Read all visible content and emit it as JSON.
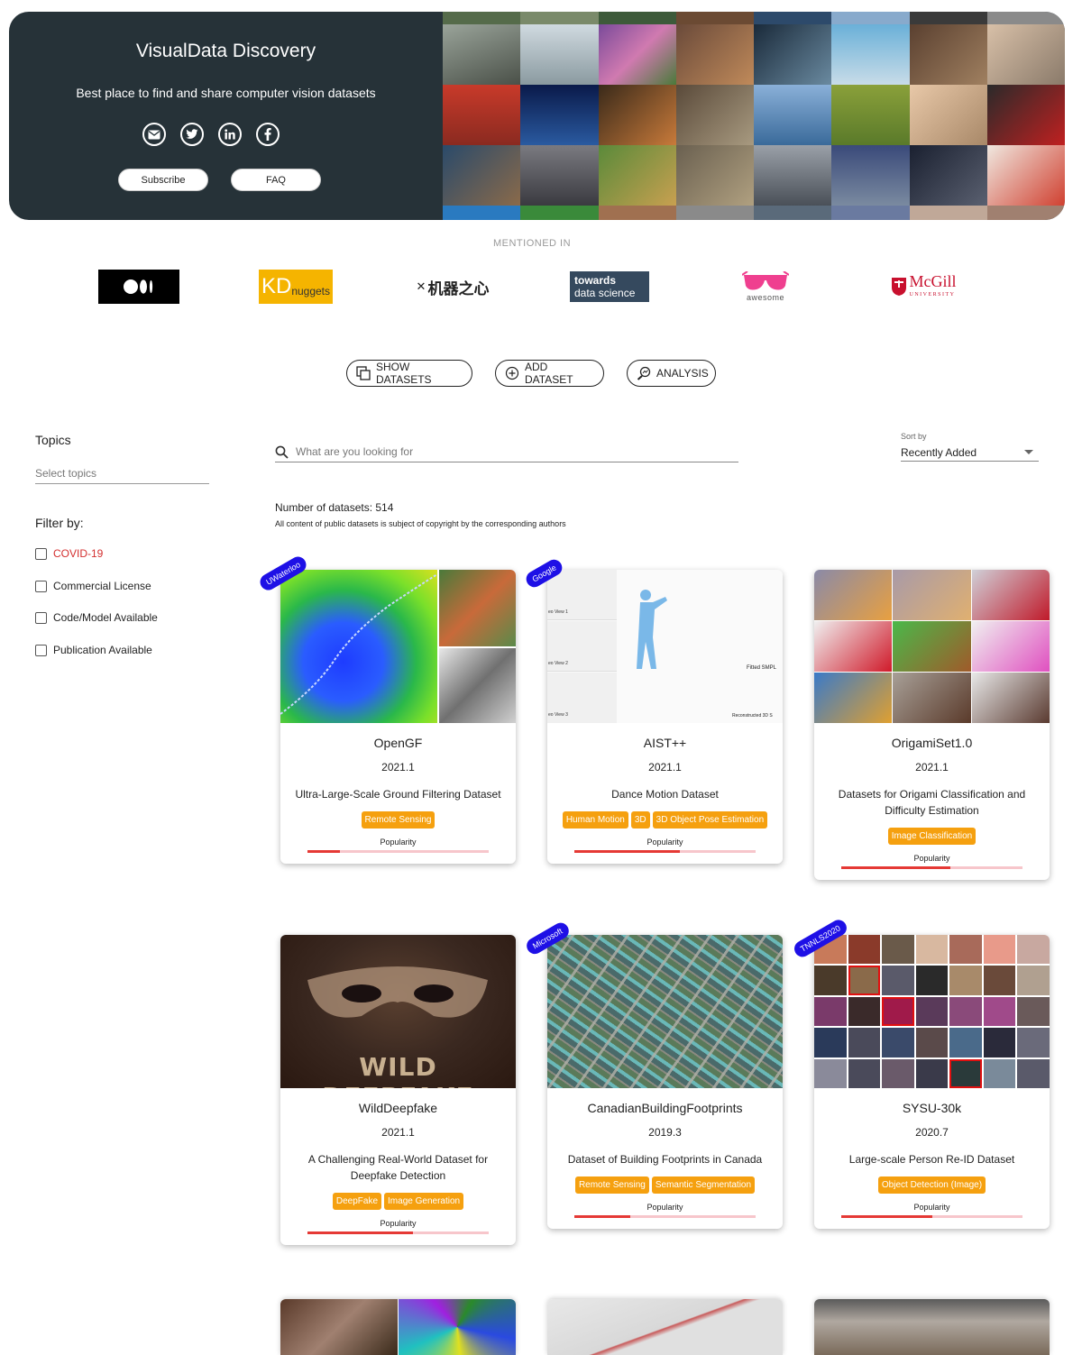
{
  "hero": {
    "title": "VisualData Discovery",
    "subtitle": "Best place to find and share computer vision datasets",
    "social": [
      "email-icon",
      "twitter-icon",
      "linkedin-icon",
      "facebook-icon"
    ],
    "subscribe_label": "Subscribe",
    "faq_label": "FAQ"
  },
  "mentioned": {
    "heading": "MENTIONED IN",
    "logos": {
      "kd_a": "KD",
      "kd_b": "nuggets",
      "jiqi": "机器之心",
      "tds_a": "towards",
      "tds_b": "data science",
      "awesome": "awesome",
      "mcgill_a": "McGill",
      "mcgill_b": "UNIVERSITY"
    }
  },
  "actions": {
    "show": "SHOW DATASETS",
    "add": "ADD DATASET",
    "analysis": "ANALYSIS"
  },
  "sidebar": {
    "topics_title": "Topics",
    "topics_placeholder": "Select topics",
    "filter_title": "Filter by:",
    "filters": [
      "COVID-19",
      "Commercial License",
      "Code/Model Available",
      "Publication Available"
    ]
  },
  "search": {
    "placeholder": "What are you looking for"
  },
  "sort": {
    "label": "Sort by",
    "value": "Recently Added"
  },
  "count_text": "Number of datasets: 514",
  "copyright_text": "All content of public datasets is subject of copyright by the corresponding authors",
  "cards": [
    {
      "title": "OpenGF",
      "version": "2021.1",
      "desc": "Ultra-Large-Scale Ground Filtering Dataset",
      "tags": [
        "Remote Sensing"
      ],
      "popularity_label": "Popularity",
      "popularity": 0.18,
      "badge": "UWaterloo"
    },
    {
      "title": "AIST++",
      "version": "2021.1",
      "desc": "Dance Motion Dataset",
      "tags": [
        "Human Motion",
        "3D",
        "3D Object Pose Estimation"
      ],
      "popularity_label": "Popularity",
      "popularity": 0.58,
      "badge": "Google",
      "img_text": {
        "fitted": "Fitted SMPL",
        "recon": "Reconstructed 3D S",
        "v1": "eo View 1",
        "v2": "eo View 2",
        "v3": "eo View 3"
      }
    },
    {
      "title": "OrigamiSet1.0",
      "version": "2021.1",
      "desc": "Datasets for Origami Classification and Difficulty Estimation",
      "tags": [
        "Image Classification"
      ],
      "popularity_label": "Popularity",
      "popularity": 0.6,
      "badge": ""
    },
    {
      "title": "WildDeepfake",
      "version": "2021.1",
      "desc": "A Challenging Real-World Dataset for Deepfake Detection",
      "tags": [
        "DeepFake",
        "Image Generation"
      ],
      "popularity_label": "Popularity",
      "popularity": 0.58,
      "badge": "",
      "img_text": "WILD DEEPFAKE"
    },
    {
      "title": "CanadianBuildingFootprints",
      "version": "2019.3",
      "desc": "Dataset of Building Footprints in Canada",
      "tags": [
        "Remote Sensing",
        "Semantic Segmentation"
      ],
      "popularity_label": "Popularity",
      "popularity": 0.31,
      "badge": "Microsoft"
    },
    {
      "title": "SYSU-30k",
      "version": "2020.7",
      "desc": "Large-scale Person Re-ID Dataset",
      "tags": [
        "Object Detection (Image)"
      ],
      "popularity_label": "Popularity",
      "popularity": 0.5,
      "badge": "TNNLS2020"
    }
  ],
  "colors": {
    "accent_tag": "#f5a00f",
    "badge": "#1e10e6",
    "hero_bg": "#263238",
    "popularity": "#e53935",
    "covid": "#d32f2f"
  }
}
